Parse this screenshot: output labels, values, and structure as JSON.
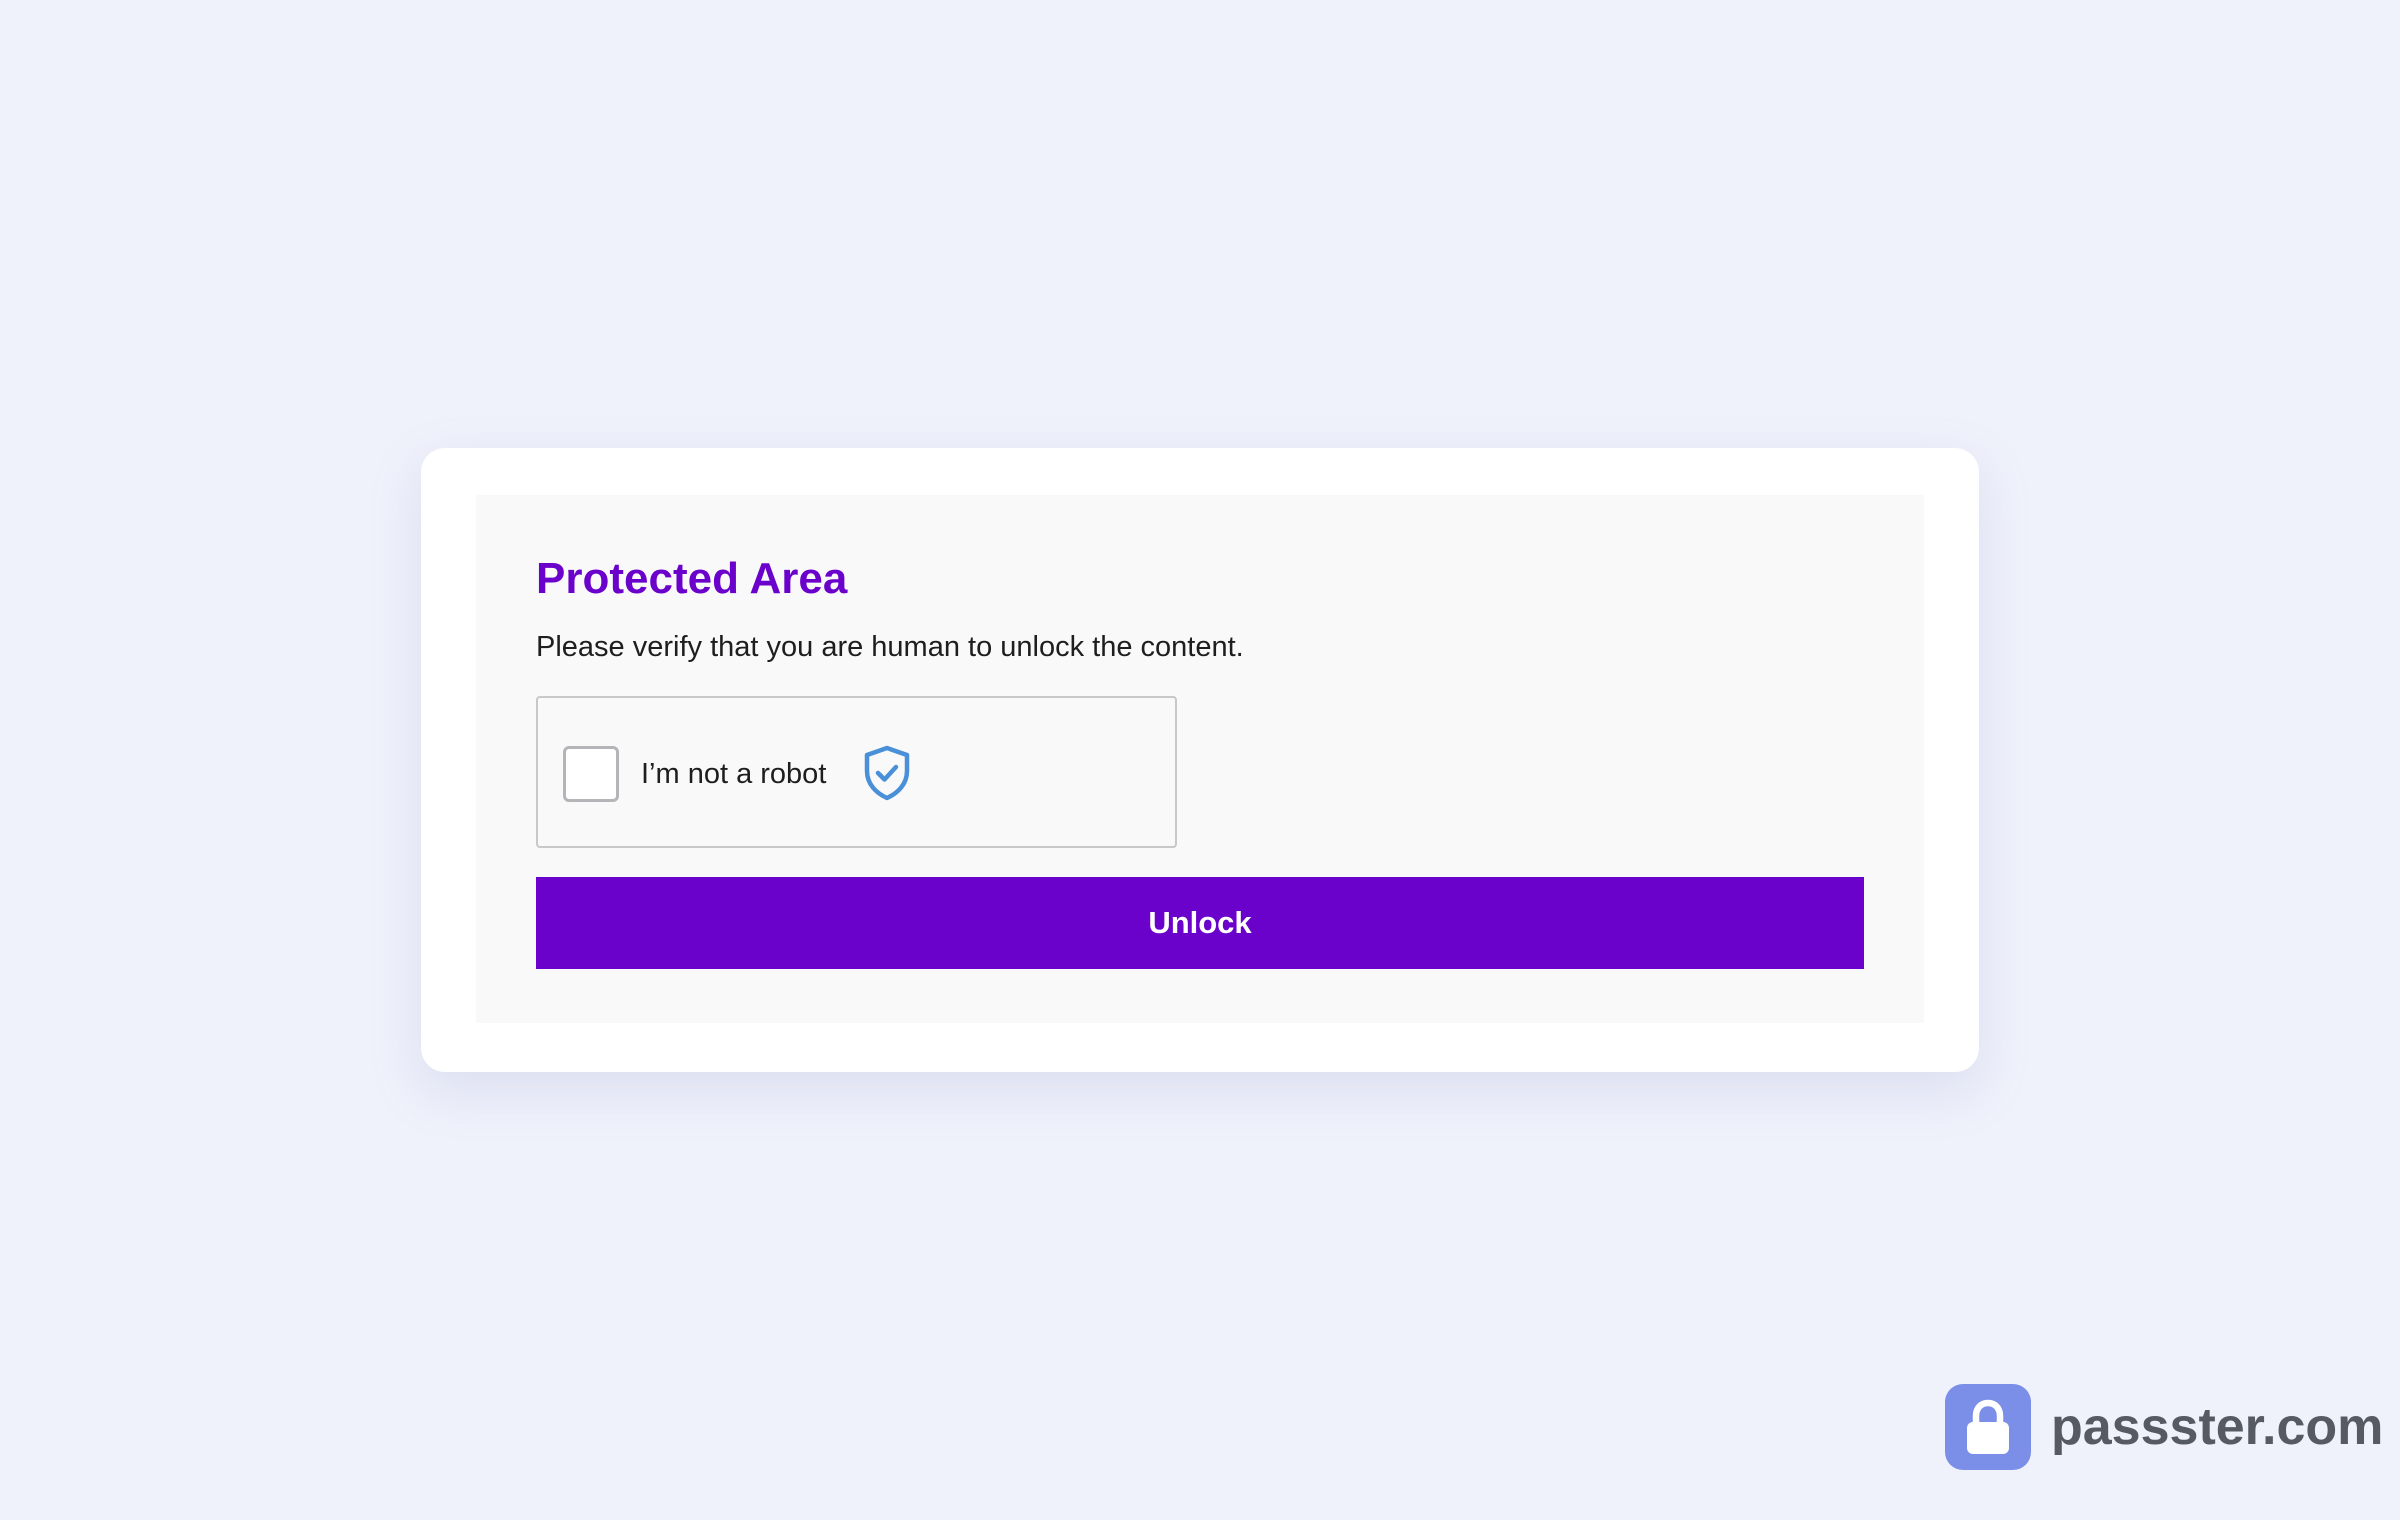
{
  "protected": {
    "title": "Protected Area",
    "subtitle": "Please verify that you are human to unlock the content.",
    "captcha": {
      "label": "I’m not a robot",
      "checked": false,
      "icon": "shield-check-icon"
    },
    "unlock_label": "Unlock"
  },
  "brand": {
    "logo_icon": "padlock-icon",
    "name": "passster.com"
  },
  "colors": {
    "background": "#eff1fb",
    "accent": "#6a02cc",
    "shield": "#4a90d9",
    "brand_logo": "#7b8fe8",
    "brand_text": "#555a63"
  }
}
